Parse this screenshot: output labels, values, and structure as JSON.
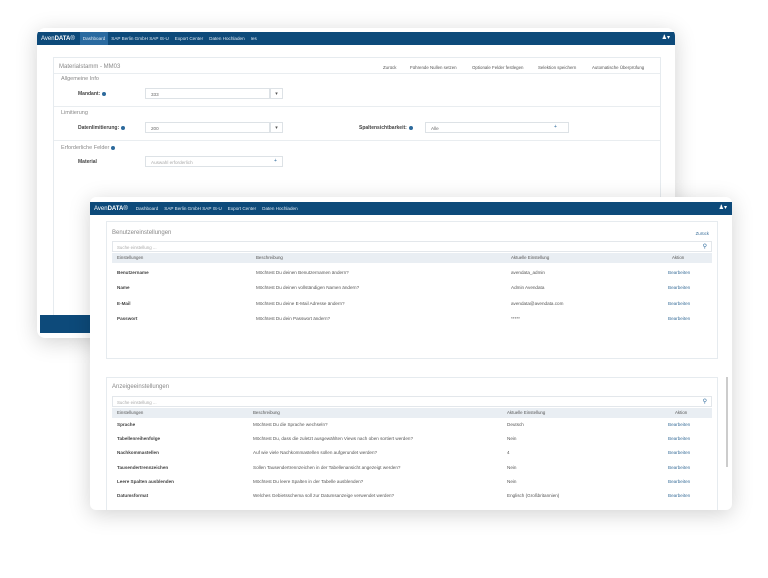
{
  "brand": {
    "prefix": "Aven",
    "bold": "DATA",
    "suffix": "®"
  },
  "back": {
    "nav": [
      "Dashboard",
      "SAP Berlin GmbH SAP IS-U",
      "Export Center",
      "Daten Hochladen",
      "Ies"
    ],
    "title": "Materialstamm - MM03",
    "actions": [
      "Zurück",
      "Führende Nullen setzen",
      "Optionale Felder festlegen",
      "Selektion speichern",
      "Automatische Überprüfung"
    ],
    "sections": [
      {
        "title": "Allgemeine Info",
        "label": "Mandant:",
        "value": "333"
      },
      {
        "title": "Limitierung",
        "label": "Datenlimitierung:",
        "value": "200",
        "label2": "Spaltensichtbarkeit:",
        "value2": "Alle"
      },
      {
        "title": "Erforderliche Felder",
        "label": "Material",
        "placeholder": "Auswahl erforderlich"
      }
    ]
  },
  "front": {
    "nav": [
      "Dashboard",
      "SAP Berlin GmbH SAP IS-U",
      "Export Center",
      "Daten Hochladen"
    ],
    "user": {
      "title": "Benutzereinstellungen",
      "back": "Zurück",
      "search_placeholder": "Suche einstellung ...",
      "columns": [
        "Einstellungen",
        "Beschreibung",
        "Aktuelle Einstellung",
        "Aktion"
      ],
      "rows": [
        [
          "Benutzername",
          "Möchtest Du deinen Benutzernamen ändern?",
          "avendata_admin",
          "Bearbeiten"
        ],
        [
          "Name",
          "Möchtest Du deinen vollständigen Namen ändern?",
          "Admin Avendata",
          "Bearbeiten"
        ],
        [
          "E-Mail",
          "Möchtest Du deine E-Mail Adresse ändern?",
          "avendata@avendata.com",
          "Bearbeiten"
        ],
        [
          "Passwort",
          "Möchtest Du dein Passwort ändern?",
          "*****",
          "Bearbeiten"
        ]
      ]
    },
    "display": {
      "title": "Anzeigeeinstellungen",
      "search_placeholder": "Suche einstellung ...",
      "columns": [
        "Einstellungen",
        "Beschreibung",
        "Aktuelle Einstellung",
        "Aktion"
      ],
      "rows": [
        [
          "Sprache",
          "Möchtest Du die Sprache wechseln?",
          "Deutsch",
          "Bearbeiten"
        ],
        [
          "Tabellenreihenfolge",
          "Möchtest Du, dass die zuletzt ausgewählten Views nach oben sortiert werden?",
          "Nein",
          "Bearbeiten"
        ],
        [
          "Nachkommastellen",
          "Auf wie viele Nachkommastellen sollen aufgerundet werden?",
          "4",
          "Bearbeiten"
        ],
        [
          "Tausendertrennzeichen",
          "Sollen Tausendertrennzeichen in der Tabellenansicht angezeigt werden?",
          "Nein",
          "Bearbeiten"
        ],
        [
          "Leere Spalten ausblenden",
          "Möchtest Du leere Spalten in der Tabelle ausblenden?",
          "Nein",
          "Bearbeiten"
        ],
        [
          "Datumsformat",
          "Welches Gebietsschema soll zur Datumsanzeige verwendet werden?",
          "Englisch (Großbritannien)",
          "Bearbeiten"
        ]
      ]
    }
  },
  "colors": {
    "nav": "#0d4a7a",
    "link": "#3a6f9a"
  }
}
